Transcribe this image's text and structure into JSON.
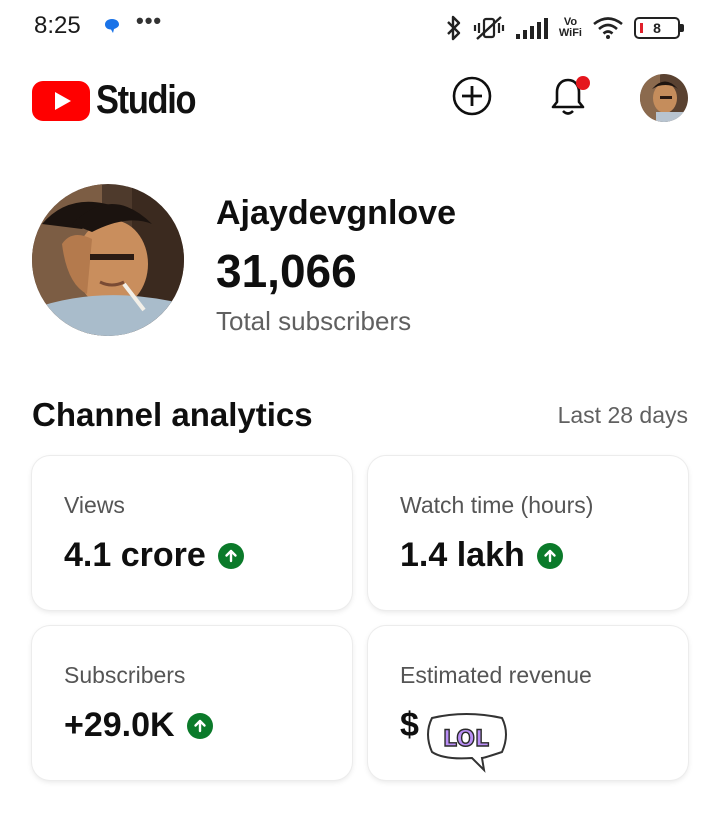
{
  "status_bar": {
    "time": "8:25",
    "dots": "•••",
    "network_label_line1": "Vo",
    "network_label_line2": "WiFi",
    "battery": "8"
  },
  "header": {
    "app_name": "Studio",
    "brand_color": "#ff0000"
  },
  "channel": {
    "name": "Ajaydevgnlove",
    "subscriber_count": "31,066",
    "subscriber_label": "Total subscribers"
  },
  "analytics": {
    "title": "Channel analytics",
    "range": "Last 28 days",
    "cards": [
      {
        "label": "Views",
        "value": "4.1 crore",
        "trend": "up"
      },
      {
        "label": "Watch time (hours)",
        "value": "1.4 lakh",
        "trend": "up"
      },
      {
        "label": "Subscribers",
        "value": "+29.0K",
        "trend": "up"
      },
      {
        "label": "Estimated revenue",
        "value": "$",
        "trend": "obscured"
      }
    ],
    "trend_color": "#0b7a2a"
  },
  "sticker": {
    "text": "LOL"
  }
}
